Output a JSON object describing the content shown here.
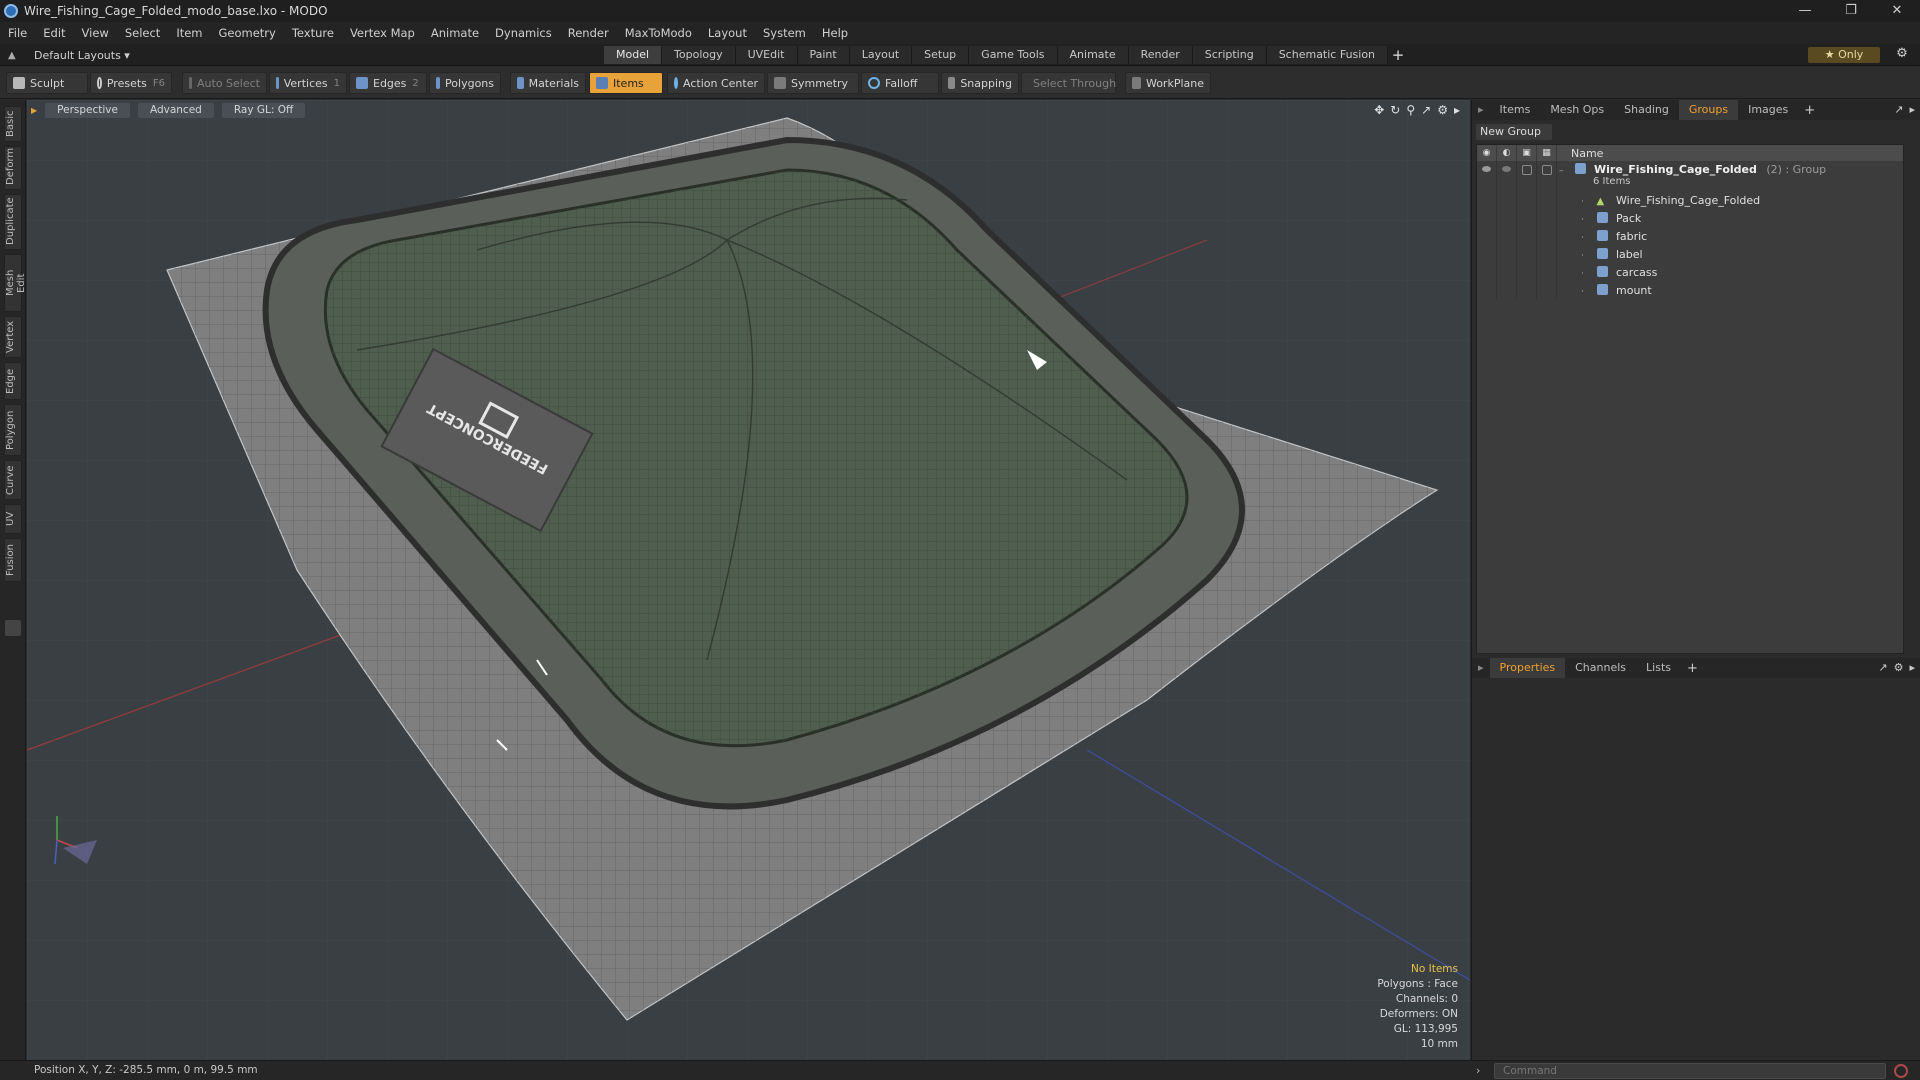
{
  "window": {
    "title": "Wire_Fishing_Cage_Folded_modo_base.lxo - MODO",
    "controls": [
      "—",
      "❐",
      "✕"
    ]
  },
  "menu": [
    "File",
    "Edit",
    "View",
    "Select",
    "Item",
    "Geometry",
    "Texture",
    "Vertex Map",
    "Animate",
    "Dynamics",
    "Render",
    "MaxToModo",
    "Layout",
    "System",
    "Help"
  ],
  "layout": {
    "dropdown": "Default Layouts ▾"
  },
  "tabs": [
    "Model",
    "Topology",
    "UVEdit",
    "Paint",
    "Layout",
    "Setup",
    "Game Tools",
    "Animate",
    "Render",
    "Scripting",
    "Schematic Fusion"
  ],
  "only_label": "★  Only",
  "toolbar": {
    "sculpt": "Sculpt",
    "presets": "Presets",
    "presets_key": "F6",
    "auto_select": "Auto Select",
    "vertices": "Vertices",
    "vertices_key": "1",
    "edges": "Edges",
    "edges_key": "2",
    "polygons": "Polygons",
    "materials": "Materials",
    "items": "Items",
    "action_center": "Action Center",
    "symmetry": "Symmetry",
    "falloff": "Falloff",
    "snapping": "Snapping",
    "select_through": "Select Through",
    "workplane": "WorkPlane"
  },
  "left_tabs": [
    "Basic",
    "Deform",
    "Duplicate",
    "Mesh Edit",
    "Vertex",
    "Edge",
    "Polygon",
    "Curve",
    "UV",
    "Fusion"
  ],
  "viewport": {
    "perspective": "Perspective",
    "advanced": "Advanced",
    "raygl": "Ray GL: Off",
    "label_text": "FEEDERCONCEPT",
    "info": {
      "no_items": "No Items",
      "polygons": "Polygons : Face",
      "channels": "Channels: 0",
      "deformers": "Deformers: ON",
      "gl": "GL: 113,995",
      "scale": "10 mm"
    }
  },
  "panel_top": {
    "tabs": [
      "Items",
      "Mesh Ops",
      "Shading",
      "Groups",
      "Images"
    ],
    "active": "Groups",
    "new_group": "New Group",
    "column_name": "Name",
    "group": {
      "name": "Wire_Fishing_Cage_Folded",
      "sub": "(2) : Group",
      "count": "6 Items"
    },
    "children": [
      "Wire_Fishing_Cage_Folded",
      "Pack",
      "fabric",
      "label",
      "carcass",
      "mount"
    ]
  },
  "panel_bottom": {
    "tabs": [
      "Properties",
      "Channels",
      "Lists"
    ],
    "active": "Properties"
  },
  "status": {
    "position": "Position X, Y, Z:  -285.5 mm, 0 m, 99.5 mm",
    "command_placeholder": "Command"
  },
  "colors": {
    "accent": "#e8a23a",
    "viewport_bg": "#3a3f44",
    "info_highlight": "#e8c34a",
    "mesh_green": "#4f5e4e"
  }
}
